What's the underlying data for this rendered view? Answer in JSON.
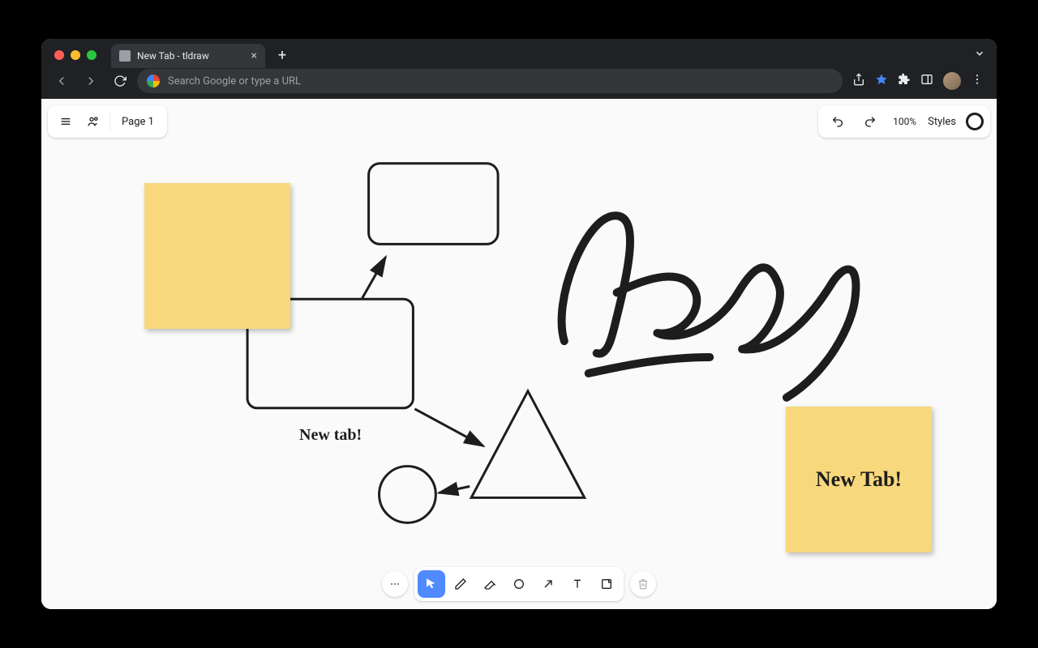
{
  "browser": {
    "tab_title": "New Tab - tldraw",
    "omnibox_placeholder": "Search Google or type a URL"
  },
  "topbar": {
    "page_label": "Page 1",
    "zoom": "100%",
    "styles_label": "Styles"
  },
  "canvas": {
    "sticky1_text": "",
    "sticky2_text": "New Tab!",
    "label1": "New tab!",
    "handwriting": "Hey"
  },
  "tools": {
    "more": "more",
    "select": "select",
    "draw": "draw",
    "erase": "erase",
    "shape": "shape",
    "arrow": "arrow",
    "text": "text",
    "note": "note",
    "trash": "trash"
  }
}
